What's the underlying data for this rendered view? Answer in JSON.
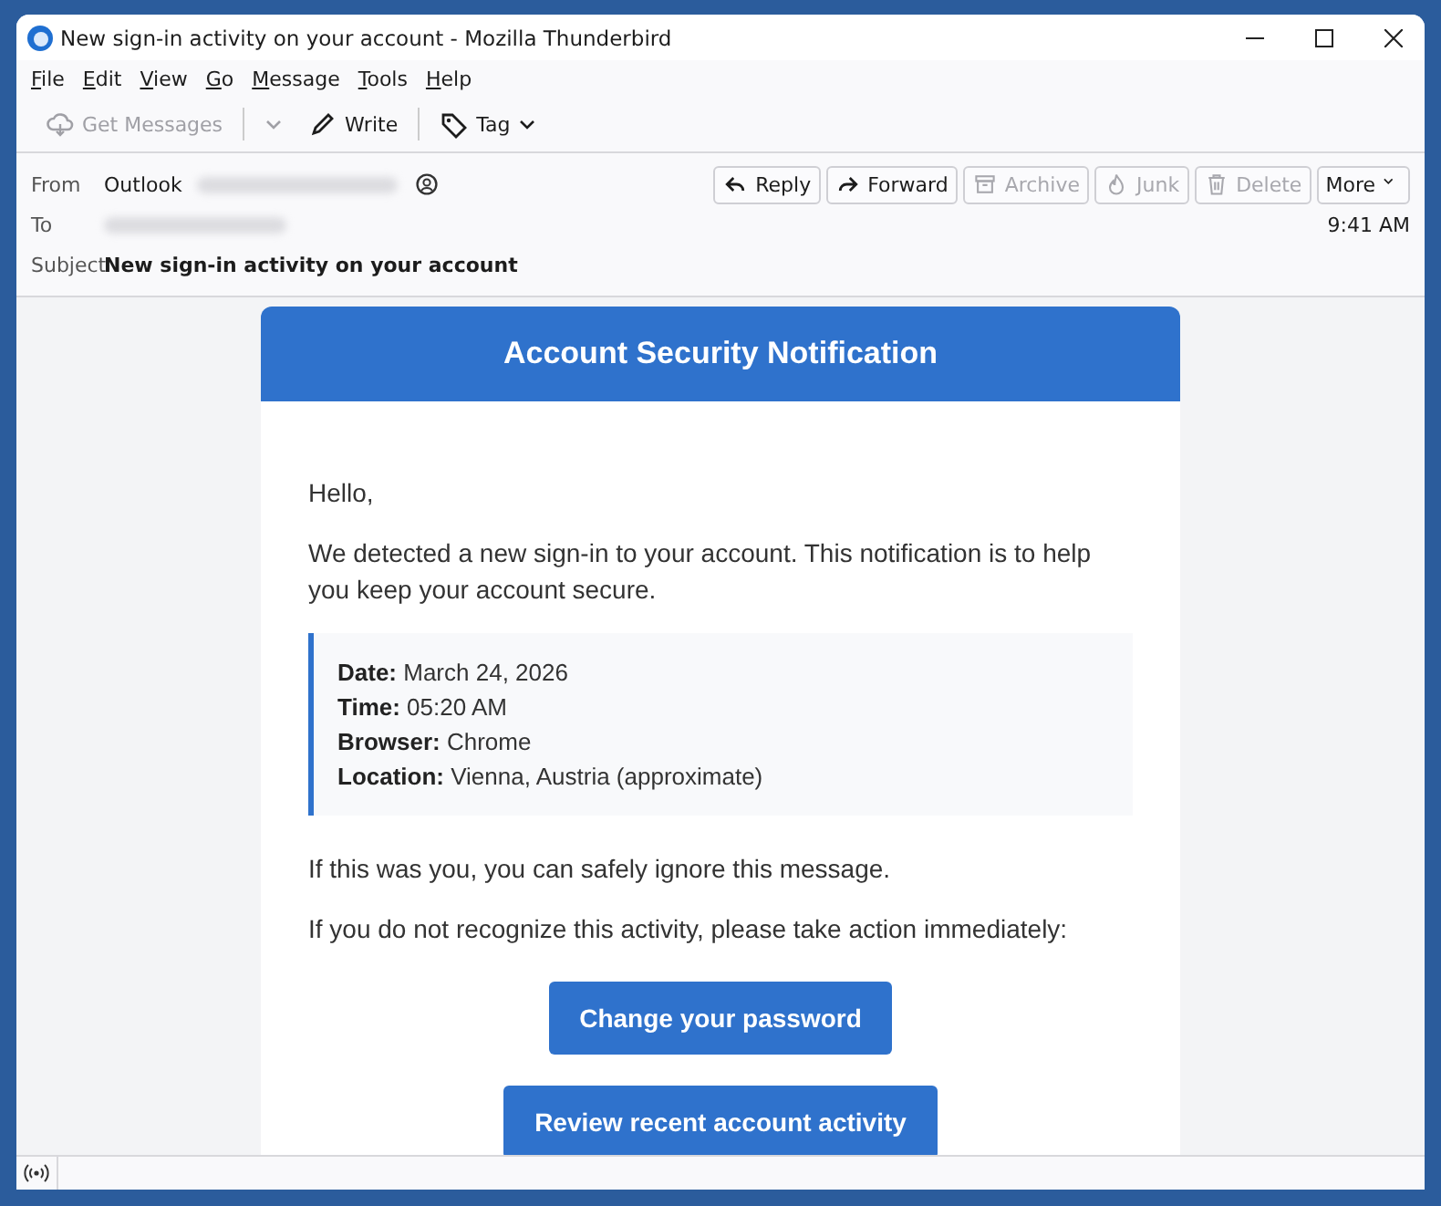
{
  "window": {
    "title": "New sign-in activity on your account - Mozilla Thunderbird"
  },
  "menu": [
    {
      "label": "File"
    },
    {
      "label": "Edit"
    },
    {
      "label": "View"
    },
    {
      "label": "Go"
    },
    {
      "label": "Message"
    },
    {
      "label": "Tools"
    },
    {
      "label": "Help"
    }
  ],
  "toolbar": [
    {
      "kind": "get",
      "label": "Get Messages",
      "disabled": true
    },
    {
      "kind": "write",
      "label": "Write",
      "disabled": false
    },
    {
      "kind": "tag",
      "label": "Tag",
      "disabled": false
    }
  ],
  "message_actions": [
    {
      "kind": "reply",
      "label": "Reply",
      "disabled": false
    },
    {
      "kind": "forward",
      "label": "Forward",
      "disabled": false
    },
    {
      "kind": "archive",
      "label": "Archive",
      "disabled": true
    },
    {
      "kind": "junk",
      "label": "Junk",
      "disabled": true
    },
    {
      "kind": "delete",
      "label": "Delete",
      "disabled": true
    },
    {
      "kind": "more",
      "label": "More",
      "disabled": false
    }
  ],
  "header": {
    "from_label": "From",
    "from": "Outlook",
    "to_label": "To",
    "subject_label": "Subject",
    "subject": "New sign-in activity on your account",
    "time": "9:41 AM"
  },
  "email": {
    "title": "Account Security Notification",
    "greeting": "Hello,",
    "intro": "We detected a new sign-in to your account. This notification is to help you keep your account secure.",
    "details": [
      {
        "label": "Date:",
        "value": "March 24, 2026"
      },
      {
        "label": "Time:",
        "value": "05:20 AM"
      },
      {
        "label": "Browser:",
        "value": "Chrome"
      },
      {
        "label": "Location:",
        "value": "Vienna, Austria (approximate)"
      }
    ],
    "notes": [
      "If this was you, you can safely ignore this message.",
      "If you do not recognize this activity, please take action immediately:"
    ],
    "buttons": [
      "Change your password",
      "Review recent account activity"
    ]
  }
}
